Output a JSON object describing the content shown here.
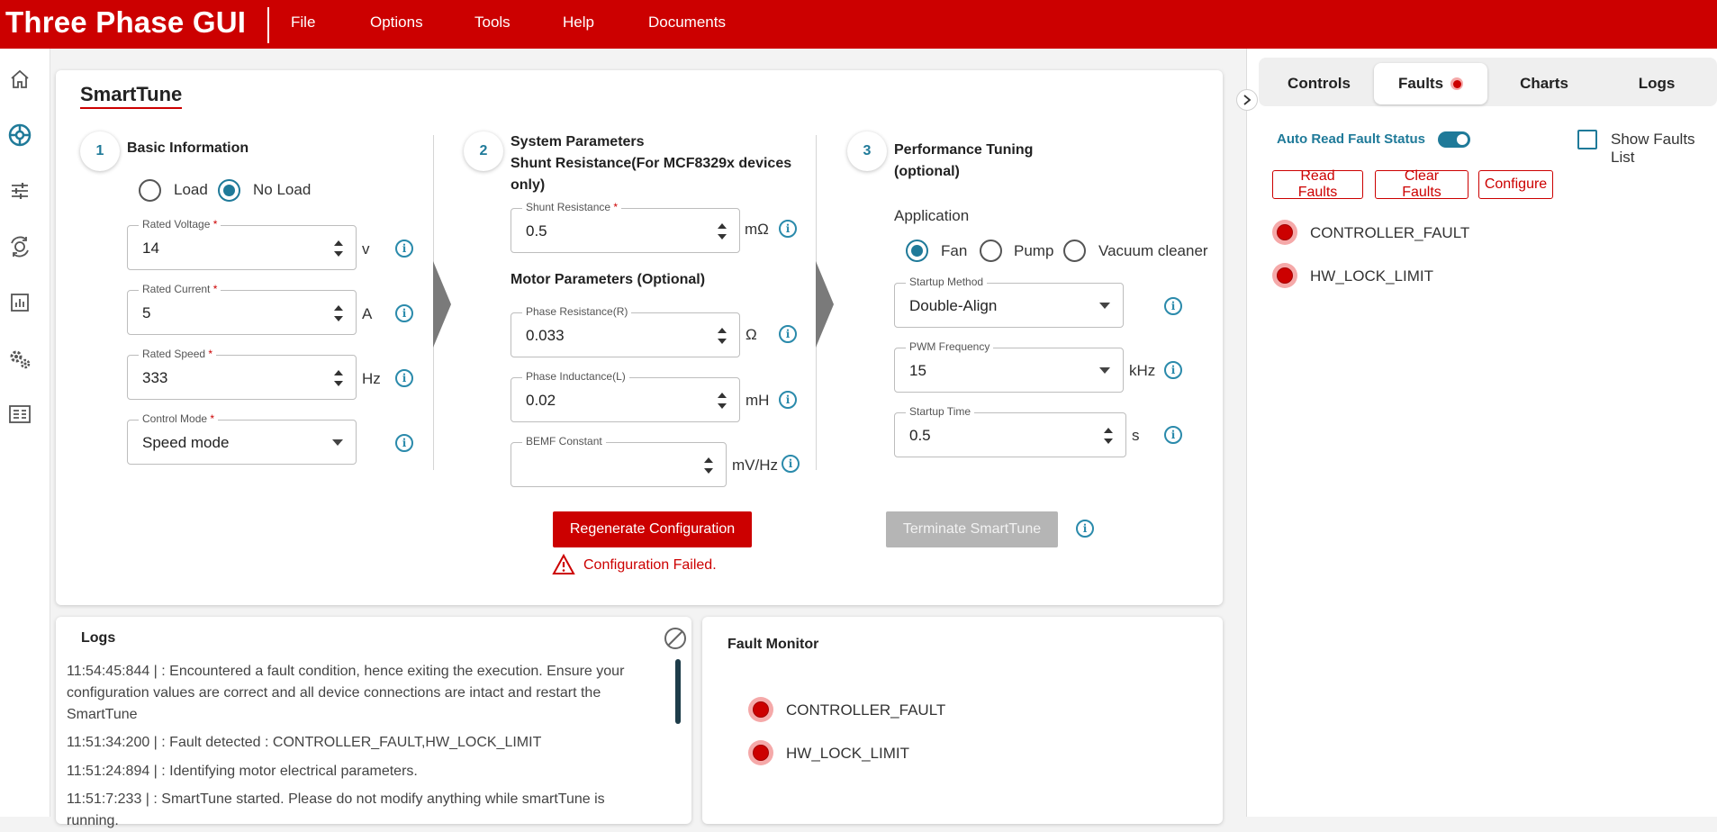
{
  "app": {
    "title": "Three Phase GUI",
    "menu": [
      "File",
      "Options",
      "Tools",
      "Help",
      "Documents"
    ]
  },
  "siderail": {
    "icons": [
      "home-icon",
      "smarttune-icon",
      "tuning-sliders-icon",
      "motor-rotation-icon",
      "chart-icon",
      "settings-gears-icon",
      "register-map-icon"
    ]
  },
  "smarttune": {
    "title": "SmartTune",
    "step1": {
      "number": "1",
      "title": "Basic Information",
      "load_options": [
        "Load",
        "No Load"
      ],
      "load_selected": "No Load",
      "rated_voltage": {
        "label": "Rated Voltage",
        "required": "*",
        "value": "14",
        "unit": "v"
      },
      "rated_current": {
        "label": "Rated Current",
        "required": "*",
        "value": "5",
        "unit": "A"
      },
      "rated_speed": {
        "label": "Rated Speed",
        "required": "*",
        "value": "333",
        "unit": "Hz"
      },
      "control_mode": {
        "label": "Control Mode",
        "required": "*",
        "value": "Speed mode"
      }
    },
    "step2": {
      "number": "2",
      "title_line1": "System Parameters",
      "title_line2": "Shunt Resistance(For MCF8329x devices only)",
      "shunt_resistance": {
        "label": "Shunt Resistance",
        "required": "*",
        "value": "0.5",
        "unit": "mΩ"
      },
      "motor_title": "Motor Parameters (Optional)",
      "phase_resistance": {
        "label": "Phase Resistance(R)",
        "value": "0.033",
        "unit": "Ω"
      },
      "phase_inductance": {
        "label": "Phase Inductance(L)",
        "value": "0.02",
        "unit": "mH"
      },
      "bemf_constant": {
        "label": "BEMF Constant",
        "value": "",
        "unit": "mV/Hz"
      }
    },
    "step3": {
      "number": "3",
      "title_line1": "Performance Tuning",
      "title_line2": "(optional)",
      "application_label": "Application",
      "application_options": [
        "Fan",
        "Pump",
        "Vacuum cleaner"
      ],
      "application_selected": "Fan",
      "startup_method": {
        "label": "Startup Method",
        "value": "Double-Align"
      },
      "pwm_frequency": {
        "label": "PWM Frequency",
        "value": "15",
        "unit": "kHz"
      },
      "startup_time": {
        "label": "Startup Time",
        "value": "0.5",
        "unit": "s"
      }
    },
    "regenerate_button": "Regenerate Configuration",
    "terminate_button": "Terminate SmartTune",
    "error_message": "Configuration Failed."
  },
  "logs": {
    "title": "Logs",
    "entries": [
      "11:54:45:844 | : Encountered a fault condition, hence exiting the execution. Ensure your configuration values are correct and all device connections are intact and restart the SmartTune",
      "11:51:34:200 | : Fault detected : CONTROLLER_FAULT,HW_LOCK_LIMIT",
      "11:51:24:894 | : Identifying motor electrical parameters.",
      "11:51:7:233 | : SmartTune started. Please do not modify anything while smartTune is running."
    ]
  },
  "fault_monitor": {
    "title": "Fault Monitor",
    "faults": [
      "CONTROLLER_FAULT",
      "HW_LOCK_LIMIT"
    ]
  },
  "right_panel": {
    "tabs": [
      "Controls",
      "Faults",
      "Charts",
      "Logs"
    ],
    "active_tab": "Faults",
    "auto_read_label": "Auto Read Fault Status",
    "auto_read_enabled": true,
    "show_faults_list_label": "Show Faults List",
    "buttons": [
      "Read Faults",
      "Clear Faults",
      "Configure"
    ],
    "faults": [
      "CONTROLLER_FAULT",
      "HW_LOCK_LIMIT"
    ]
  },
  "colors": {
    "brand_red": "#cc0000",
    "accent_teal": "#1f7a99",
    "fault_red": "#cc0000"
  }
}
